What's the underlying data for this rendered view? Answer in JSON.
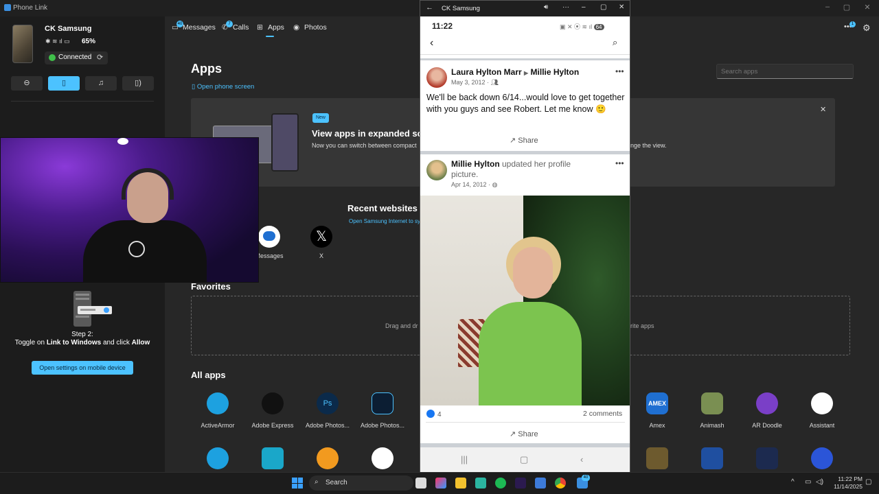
{
  "window": {
    "title": "Phone Link"
  },
  "device": {
    "name": "CK Samsung",
    "battery": "65%",
    "status": "Connected"
  },
  "sidebar": {
    "step_label": "Step 2:",
    "step_prefix": "Toggle on ",
    "step_bold1": "Link to Windows",
    "step_mid": " and click ",
    "step_bold2": "Allow",
    "open_settings": "Open settings on mobile device"
  },
  "tabs": [
    {
      "label": "Messages",
      "badge": "40"
    },
    {
      "label": "Calls",
      "badge": "7"
    },
    {
      "label": "Apps"
    },
    {
      "label": "Photos"
    }
  ],
  "header": {
    "more_badge": "1"
  },
  "apps_page": {
    "title": "Apps",
    "open_phone": "Open phone screen",
    "search_placeholder": "Search apps",
    "banner": {
      "badge": "New",
      "title": "View apps in expanded scr",
      "text": "Now you can switch between compact",
      "text_end": "nge the view."
    },
    "recent_title": "Recent websites",
    "recent_sub": "Open Samsung Internet to sy",
    "recent": [
      {
        "label": "Messages"
      },
      {
        "label": "X"
      }
    ],
    "favorites_title": "Favorites",
    "favorites_text_left": "Drag and dr",
    "favorites_text_right": "rite apps",
    "all_apps_title": "All apps",
    "all_apps_row1": [
      {
        "label": "ActiveArmor",
        "color": "#1da1e0"
      },
      {
        "label": "Adobe Express",
        "color": "#111111"
      },
      {
        "label": "Adobe Photos...",
        "color": "#0b2a4a"
      },
      {
        "label": "Adobe Photos...",
        "color": "#0c1e33"
      },
      {
        "label": "Amex",
        "color": "#1f6fd1"
      },
      {
        "label": "Animash",
        "color": "#7a8f52"
      },
      {
        "label": "AR Doodle",
        "color": "#7a3fc7"
      },
      {
        "label": "Assistant",
        "color": "#ffffff"
      }
    ]
  },
  "phone": {
    "window_title": "CK Samsung",
    "time": "11:22",
    "battery": "64",
    "post1": {
      "author": "Laura Hylton Marr",
      "arrow": "▶",
      "target": "Millie Hylton",
      "date": "May 3, 2012 ·",
      "text": "We'll be back down 6/14...would love to get together with you guys and see Robert.  Let me know 🙂",
      "share": "Share"
    },
    "post2": {
      "author": "Millie Hylton",
      "action": " updated her profile picture.",
      "date": "Apr 14, 2012 ·",
      "likes": "4",
      "comments": "2 comments",
      "share": "Share"
    }
  },
  "taskbar": {
    "search": "Search",
    "time": "11:22 PM",
    "date": "11/14/2025",
    "phonelink_badge": "40"
  }
}
